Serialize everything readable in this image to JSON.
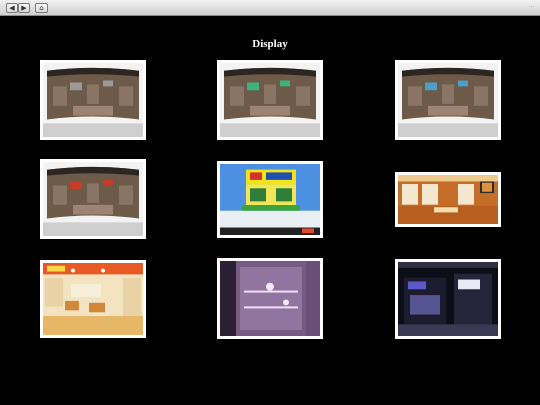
{
  "window": {
    "back_glyph": "◀",
    "forward_glyph": "▶",
    "home_glyph": "⌂",
    "right_text": "..."
  },
  "page": {
    "title": "Display"
  },
  "gallery": {
    "items": [
      {
        "name": "store-display-1",
        "kind": "curved-render",
        "accent": "#9a9a9a"
      },
      {
        "name": "store-display-2",
        "kind": "curved-render",
        "accent": "#3bb37a"
      },
      {
        "name": "store-display-3",
        "kind": "curved-render",
        "accent": "#4aa0c8"
      },
      {
        "name": "store-display-4",
        "kind": "curved-render",
        "accent": "#c83a2a"
      },
      {
        "name": "kiosk-booth",
        "kind": "kiosk",
        "accent": "#f2e21a"
      },
      {
        "name": "warm-store-interior",
        "kind": "warm-interior",
        "accent": "#e0923a"
      },
      {
        "name": "shop-interior",
        "kind": "shop",
        "accent": "#e7b768"
      },
      {
        "name": "glass-display-wall",
        "kind": "purple-glass",
        "accent": "#a07ab0"
      },
      {
        "name": "dark-exhibition-booth",
        "kind": "dark-booth",
        "accent": "#5a5ac8"
      }
    ]
  }
}
